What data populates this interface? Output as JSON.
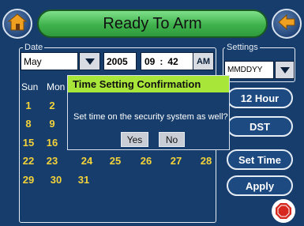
{
  "header": {
    "status_text": "Ready To Arm",
    "home_icon": "home-icon",
    "back_icon": "back-arrow-icon"
  },
  "date_group": {
    "legend": "Date",
    "month_value": "May",
    "year_value": "2005",
    "hour_value": "09",
    "time_sep": ":",
    "minute_value": "42",
    "ampm_value": "AM"
  },
  "settings_group": {
    "legend": "Settings",
    "format_value": "MMDDYY"
  },
  "calendar": {
    "headers": [
      "Sun",
      "Mon"
    ],
    "rows": [
      [
        "1",
        "2"
      ],
      [
        "8",
        "9"
      ],
      [
        "15",
        "16"
      ],
      [
        "22",
        "23",
        "24",
        "25",
        "26",
        "27",
        "28"
      ],
      [
        "29",
        "30",
        "31"
      ]
    ]
  },
  "buttons": {
    "twelve_hour": "12 Hour",
    "dst": "DST",
    "set_time": "Set Time",
    "apply": "Apply"
  },
  "dialog": {
    "title": "Time Setting Confirmation",
    "message": "Set time on the security system as well?",
    "yes": "Yes",
    "no": "No"
  },
  "colors": {
    "background": "#163d6b",
    "status_green": "#3fb24c",
    "dialog_title": "#a8e63a",
    "day_text": "#f4d23a"
  }
}
